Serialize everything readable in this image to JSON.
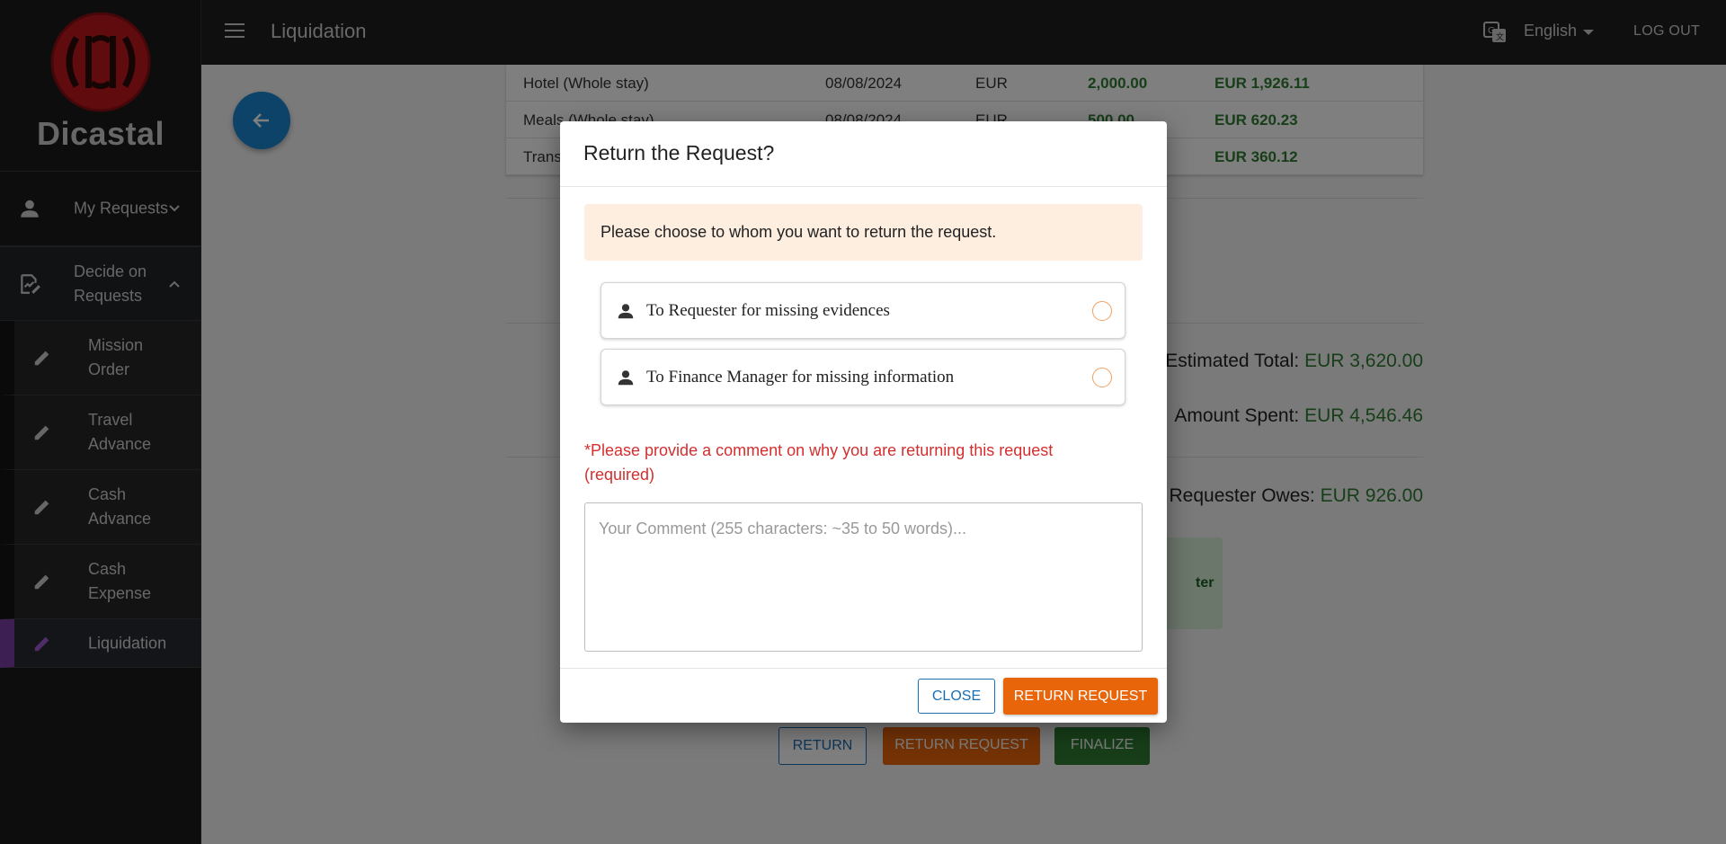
{
  "app": {
    "brand": "Dicastal",
    "page_title": "Liquidation",
    "language": "English",
    "logout_label": "LOG OUT"
  },
  "sidebar": {
    "items": [
      {
        "label": "My Requests",
        "icon": "person-icon"
      },
      {
        "label": "Decide on Requests",
        "icon": "decision-icon"
      }
    ],
    "sub_items": [
      {
        "label": "Mission Order"
      },
      {
        "label": "Travel Advance"
      },
      {
        "label": "Cash Advance"
      },
      {
        "label": "Cash Expense"
      },
      {
        "label": "Liquidation"
      }
    ]
  },
  "expenses": {
    "rows": [
      {
        "item": "Hotel (Whole stay)",
        "date": "08/08/2024",
        "currency": "EUR",
        "estimated": "2,000.00",
        "spent": "EUR 1,926.11"
      },
      {
        "item": "Meals (Whole stay)",
        "date": "08/08/2024",
        "currency": "EUR",
        "estimated": "500.00",
        "spent": "EUR 620.23"
      },
      {
        "item": "Trans",
        "date": "",
        "currency": "",
        "estimated": "",
        "spent": "EUR 360.12"
      }
    ]
  },
  "totals": {
    "estimated_label": "Estimated Total:",
    "estimated_value": "EUR 3,620.00",
    "spent_label": "Amount Spent:",
    "spent_value": "EUR 4,546.46",
    "owes_label": "Requester Owes:",
    "owes_value": "EUR 926.00",
    "green_box_text": "ter"
  },
  "actions": {
    "return_label": "RETURN",
    "return_request_label": "RETURN REQUEST",
    "finalize_label": "FINALIZE"
  },
  "modal": {
    "title": "Return the Request?",
    "notice": "Please choose to whom you want to return the request.",
    "options": [
      {
        "label": "To Requester for missing evidences"
      },
      {
        "label": "To Finance Manager for missing information"
      }
    ],
    "required_text": "*Please provide a comment on why you are returning this request (required)",
    "comment_placeholder": "Your Comment (255 characters: ~35 to 50 words)...",
    "close_label": "CLOSE",
    "return_request_label": "RETURN REQUEST"
  }
}
